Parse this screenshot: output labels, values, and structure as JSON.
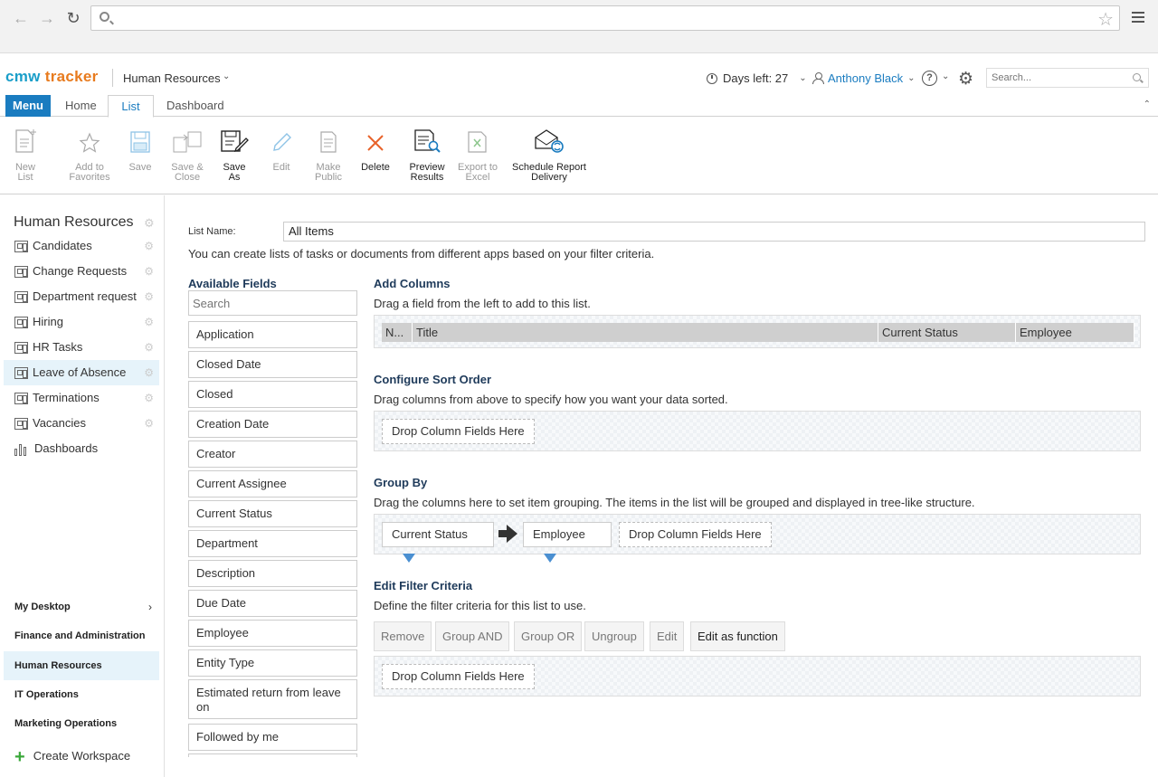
{
  "browser": {
    "search_placeholder": ""
  },
  "header": {
    "logo_part1": "cmw",
    "logo_part2": "tracker",
    "workspace": "Human Resources",
    "days_left": "Days left: 27",
    "user": "Anthony Black",
    "help": "?",
    "search_placeholder": "Search..."
  },
  "tabs": {
    "menu": "Menu",
    "home": "Home",
    "list": "List",
    "dashboard": "Dashboard"
  },
  "toolbar": {
    "new_list": "New\nList",
    "add_favorites": "Add to\nFavorites",
    "save": "Save",
    "save_close": "Save &\nClose",
    "save_as": "Save\nAs",
    "edit": "Edit",
    "make_public": "Make\nPublic",
    "delete": "Delete",
    "preview": "Preview\nResults",
    "export": "Export to\nExcel",
    "schedule": "Schedule Report\nDelivery"
  },
  "sidebar": {
    "title": "Human Resources",
    "items": [
      {
        "label": "Candidates"
      },
      {
        "label": "Change Requests"
      },
      {
        "label": "Department request"
      },
      {
        "label": "Hiring"
      },
      {
        "label": "HR Tasks"
      },
      {
        "label": "Leave of Absence"
      },
      {
        "label": "Terminations"
      },
      {
        "label": "Vacancies"
      },
      {
        "label": "Dashboards"
      }
    ],
    "workspaces": [
      {
        "label": "My Desktop"
      },
      {
        "label": "Finance and Administration"
      },
      {
        "label": "Human Resources"
      },
      {
        "label": "IT Operations"
      },
      {
        "label": "Marketing Operations"
      }
    ],
    "create_workspace": "Create Workspace"
  },
  "main": {
    "list_name_label": "List Name:",
    "list_name_value": "All Items",
    "intro": "You can create lists of tasks or documents from different apps based on your filter criteria.",
    "available_fields_title": "Available Fields",
    "fields_search_placeholder": "Search",
    "fields": [
      "Application",
      "Closed Date",
      "Closed",
      "Creation Date",
      "Creator",
      "Current Assignee",
      "Current Status",
      "Department",
      "Description",
      "Due Date",
      "Employee",
      "Entity Type",
      "Estimated return from leave on",
      "Followed by me"
    ],
    "add_columns": {
      "title": "Add Columns",
      "desc": "Drag a field from the left to add to this list.",
      "columns": [
        "N...",
        "Title",
        "Current Status",
        "Employee"
      ]
    },
    "sort": {
      "title": "Configure Sort Order",
      "desc": "Drag columns from above to specify how you want your data sorted.",
      "drop": "Drop Column Fields Here"
    },
    "group": {
      "title": "Group By",
      "desc": "Drag the columns here to set item grouping. The items in the list will be grouped and displayed in tree-like structure.",
      "chip1": "Current Status",
      "chip2": "Employee",
      "drop": "Drop Column Fields Here"
    },
    "filter": {
      "title": "Edit Filter Criteria",
      "desc": "Define the filter criteria for this list to use.",
      "buttons": [
        "Remove",
        "Group AND",
        "Group OR",
        "Ungroup",
        "Edit",
        "Edit as function"
      ],
      "drop": "Drop Column Fields Here"
    }
  }
}
